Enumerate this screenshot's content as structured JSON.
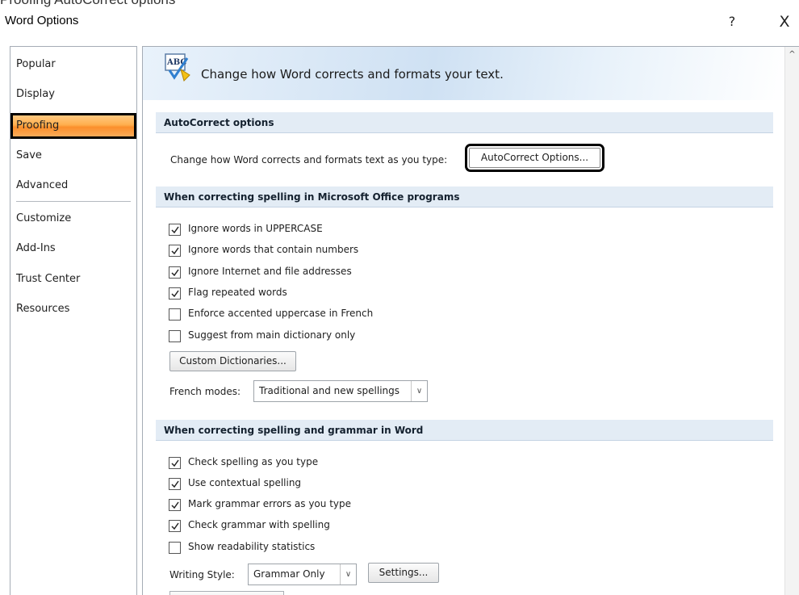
{
  "caption_fragment": "Proofing      AutoCorrect options",
  "window": {
    "title": "Word Options",
    "help_label": "?",
    "close_label": "X"
  },
  "sidebar": {
    "items": [
      {
        "label": "Popular"
      },
      {
        "label": "Display"
      },
      {
        "label": "Proofing",
        "selected": true
      },
      {
        "label": "Save"
      },
      {
        "label": "Advanced"
      },
      {
        "label": "Customize"
      },
      {
        "label": "Add-Ins"
      },
      {
        "label": "Trust Center"
      },
      {
        "label": "Resources"
      }
    ]
  },
  "banner": {
    "icon": "abc-spellcheck-icon",
    "icon_text": "ABC",
    "text": "Change how Word corrects and formats your text."
  },
  "autocorrect": {
    "heading": "AutoCorrect options",
    "description": "Change how Word corrects and formats text as you type:",
    "button_label": "AutoCorrect Options..."
  },
  "office_spelling": {
    "heading": "When correcting spelling in Microsoft Office programs",
    "options": [
      {
        "label": "Ignore words in UPPERCASE",
        "checked": true
      },
      {
        "label": "Ignore words that contain numbers",
        "checked": true
      },
      {
        "label": "Ignore Internet and file addresses",
        "checked": true
      },
      {
        "label": "Flag repeated words",
        "checked": true
      },
      {
        "label": "Enforce accented uppercase in French",
        "checked": false
      },
      {
        "label": "Suggest from main dictionary only",
        "checked": false
      }
    ],
    "custom_dictionaries_label": "Custom Dictionaries...",
    "french_modes_label": "French modes:",
    "french_modes_value": "Traditional and new spellings"
  },
  "word_spelling": {
    "heading": "When correcting spelling and grammar in Word",
    "options": [
      {
        "label": "Check spelling as you type",
        "checked": true
      },
      {
        "label": "Use contextual spelling",
        "checked": true
      },
      {
        "label": "Mark grammar errors as you type",
        "checked": true
      },
      {
        "label": "Check grammar with spelling",
        "checked": true
      },
      {
        "label": "Show readability statistics",
        "checked": false
      }
    ],
    "writing_style_label": "Writing Style:",
    "writing_style_value": "Grammar Only",
    "settings_label": "Settings..."
  }
}
